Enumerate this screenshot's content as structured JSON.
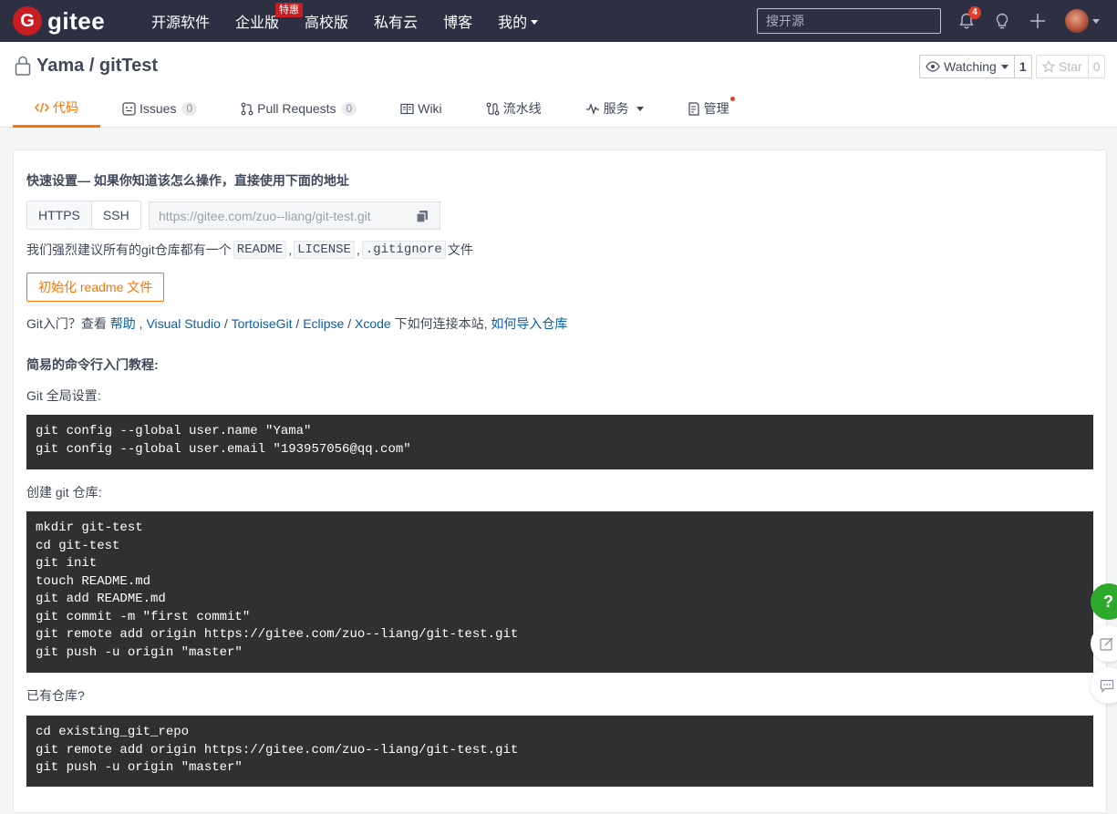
{
  "navbar": {
    "logo_letter": "G",
    "logo_text": "gitee",
    "links": [
      {
        "label": "开源软件"
      },
      {
        "label": "企业版",
        "badge": "特惠"
      },
      {
        "label": "高校版"
      },
      {
        "label": "私有云"
      },
      {
        "label": "博客"
      },
      {
        "label": "我的"
      }
    ],
    "search_placeholder": "搜开源",
    "notification_count": "4"
  },
  "repo": {
    "title": "Yama / gitTest",
    "watch_label": "Watching",
    "watch_count": "1",
    "star_label": "Star",
    "star_count": "0"
  },
  "tabs": [
    {
      "label": "代码",
      "active": true
    },
    {
      "label": "Issues",
      "count": "0"
    },
    {
      "label": "Pull Requests",
      "count": "0"
    },
    {
      "label": "Wiki"
    },
    {
      "label": "流水线"
    },
    {
      "label": "服务"
    },
    {
      "label": "管理"
    }
  ],
  "quick_setup": {
    "title": "快速设置— 如果你知道该怎么操作，直接使用下面的地址",
    "protocols": [
      "HTTPS",
      "SSH"
    ],
    "url": "https://gitee.com/zuo--liang/git-test.git",
    "recommend_prefix": "我们强烈建议所有的git仓库都有一个",
    "recommend_files": [
      "README",
      "LICENSE",
      ".gitignore"
    ],
    "sep": ",",
    "recommend_suffix": "文件",
    "init_button": "初始化 readme 文件",
    "help_prefix": "Git入门？查看",
    "help_link": "帮助",
    "help_comma": ",",
    "ide_links": [
      "Visual Studio",
      "TortoiseGit",
      "Eclipse",
      "Xcode"
    ],
    "slash": "/",
    "help_mid": "下如何连接本站,",
    "import_link": "如何导入仓库"
  },
  "tutorial": {
    "title": "简易的命令行入门教程:",
    "global_label": "Git 全局设置:",
    "global_code": "git config --global user.name \"Yama\"\ngit config --global user.email \"193957056@qq.com\"",
    "create_label": "创建 git 仓库:",
    "create_code": "mkdir git-test\ncd git-test\ngit init\ntouch README.md\ngit add README.md\ngit commit -m \"first commit\"\ngit remote add origin https://gitee.com/zuo--liang/git-test.git\ngit push -u origin \"master\"",
    "existing_label": "已有仓库?",
    "existing_code": "cd existing_git_repo\ngit remote add origin https://gitee.com/zuo--liang/git-test.git\ngit push -u origin \"master\""
  },
  "float_help": "?",
  "colors": {
    "brand": "#c71d23",
    "accent": "#fe7300",
    "link": "#095eab",
    "navbar": "#2c3042"
  }
}
